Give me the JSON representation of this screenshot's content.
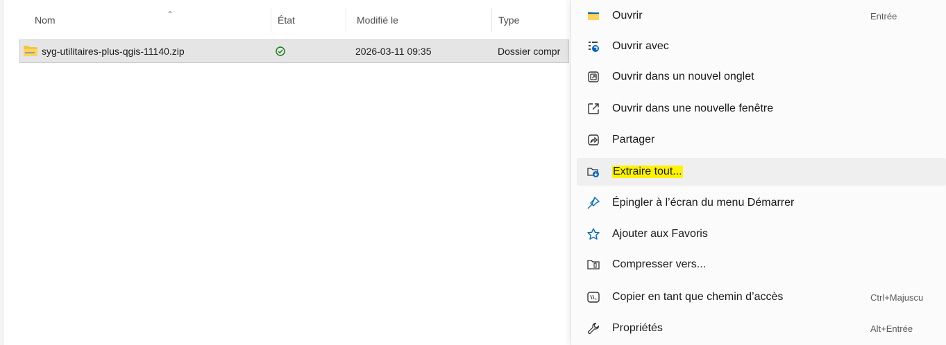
{
  "file_list": {
    "columns": [
      {
        "label": "Nom"
      },
      {
        "label": "État"
      },
      {
        "label": "Modifié le"
      },
      {
        "label": "Type"
      }
    ],
    "rows": [
      {
        "name": "syg-utilitaires-plus-qgis-11140.zip",
        "status_icon": "sync-check-icon",
        "modified": "2026-03-11 09:35",
        "type": "Dossier compr"
      }
    ]
  },
  "context_menu": {
    "items": [
      {
        "label": "Ouvrir",
        "shortcut": "Entrée",
        "icon": "folder-icon"
      },
      {
        "label": "Ouvrir avec",
        "shortcut": "",
        "icon": "open-with-icon"
      },
      {
        "label": "Ouvrir dans un nouvel onglet",
        "shortcut": "",
        "icon": "new-tab-icon"
      },
      {
        "label": "Ouvrir dans une nouvelle fenêtre",
        "shortcut": "",
        "icon": "new-window-icon"
      },
      {
        "label": "Partager",
        "shortcut": "",
        "icon": "share-icon"
      },
      {
        "label": "Extraire tout...",
        "shortcut": "",
        "icon": "extract-icon"
      },
      {
        "label": "Épingler à l’écran du menu Démarrer",
        "shortcut": "",
        "icon": "pin-icon"
      },
      {
        "label": "Ajouter aux Favoris",
        "shortcut": "",
        "icon": "star-icon"
      },
      {
        "label": "Compresser vers...",
        "shortcut": "",
        "icon": "compress-icon"
      },
      {
        "label": "Copier en tant que chemin d’accès",
        "shortcut": "Ctrl+Majuscu",
        "icon": "copy-path-icon"
      },
      {
        "label": "Propriétés",
        "shortcut": "Alt+Entrée",
        "icon": "wrench-icon"
      }
    ]
  },
  "colors": {
    "highlight": "#fff200",
    "accent": "#0067c0",
    "check": "#107c10"
  }
}
